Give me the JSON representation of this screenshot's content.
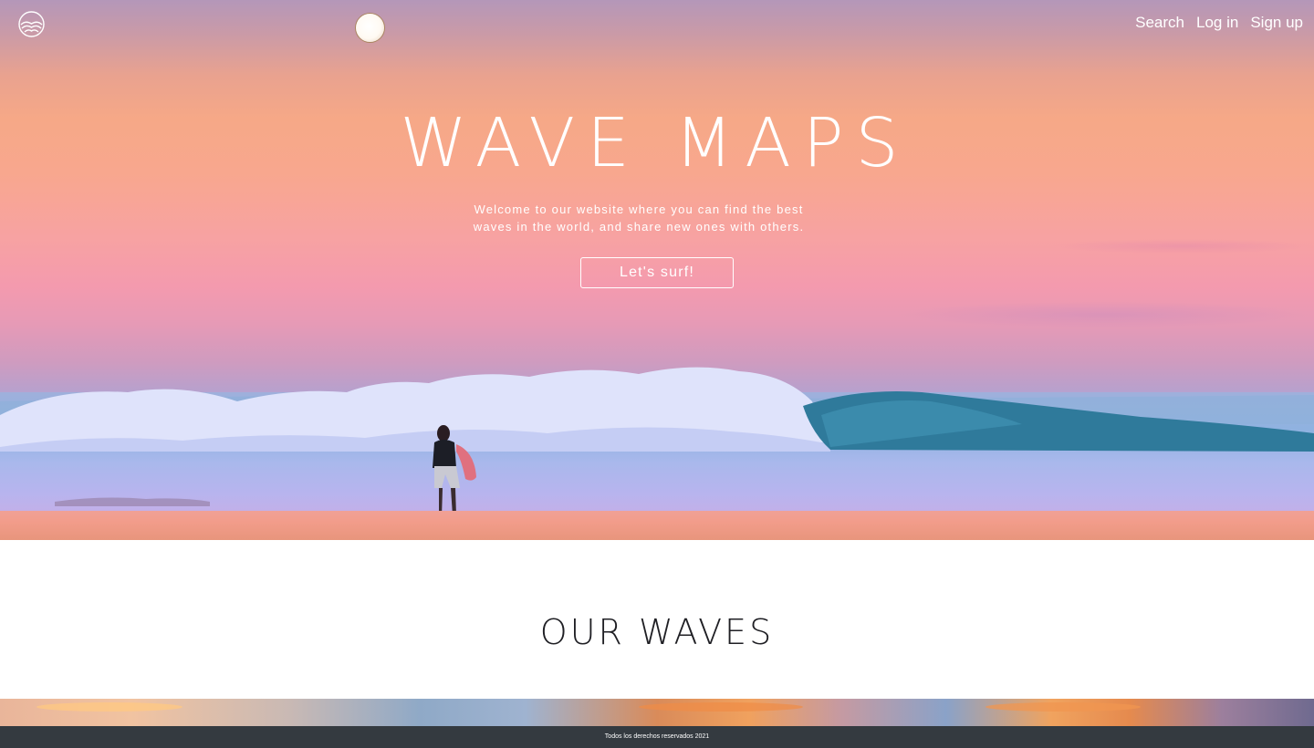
{
  "nav": {
    "logo_icon": "wave-logo-icon",
    "links": [
      {
        "label": "Search"
      },
      {
        "label": "Log in"
      },
      {
        "label": "Sign up"
      }
    ]
  },
  "hero": {
    "title": "WAVE MAPS",
    "subtitle_line1": "Welcome to our website where you can find the best",
    "subtitle_line2": "waves in the world, and share new ones with others.",
    "cta_label": "Let's surf!"
  },
  "section": {
    "title": "OUR WAVES"
  },
  "footer": {
    "text": "Todos los derechos reservados 2021"
  },
  "colors": {
    "footer_bg": "#343a40",
    "text_light": "#ffffff",
    "text_dark": "#1f1f24"
  }
}
